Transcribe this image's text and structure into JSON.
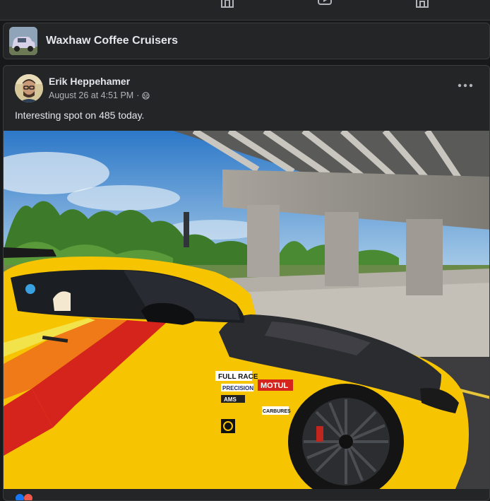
{
  "nav": {
    "icons": [
      "home-icon",
      "video-icon",
      "marketplace-icon"
    ]
  },
  "group": {
    "name": "Waxhaw Coffee Cruisers",
    "thumb_icon": "car-thumbnail"
  },
  "post": {
    "author": "Erik Heppehamer",
    "timestamp": "August 26 at 4:51 PM",
    "separator": "·",
    "privacy_icon": "group-privacy-icon",
    "caption": "Interesting spot on 485 today.",
    "more_icon": "more-options-icon",
    "photo_decals": {
      "decal1": "FULL RACE",
      "decal2": "PRECISION",
      "decal3": "MOTUL",
      "decal4": "AMS",
      "decal5": "CARBURES"
    }
  },
  "colors": {
    "background": "#18191a",
    "card": "#242526",
    "text_primary": "#e4e6eb",
    "text_secondary": "#b0b3b8",
    "car_yellow": "#f6c400",
    "car_red": "#d4241c",
    "car_orange": "#ef7a17"
  }
}
